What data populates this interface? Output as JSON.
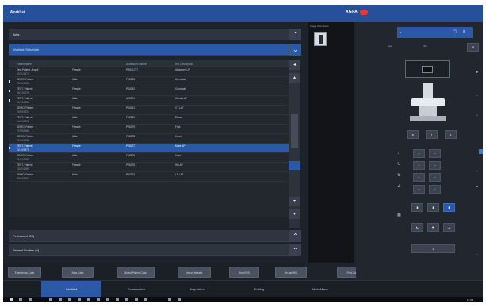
{
  "app": {
    "title": "Worklist",
    "brand": "AGFA"
  },
  "collapsed_rows": [
    "Jobs",
    "Worklist: Schedule",
    "Performed (23)",
    "Recent Studies (4)"
  ],
  "worklist": {
    "headers": [
      "Patient name",
      "Accession Number",
      "RIS Description"
    ],
    "rows": [
      {
        "name": "Test-Patient, Angeli",
        "sub": "02/11/1974",
        "gender": "Female",
        "acc": "PR001277",
        "desc": "Abdomen UP"
      },
      {
        "name": "DEMO, Patient",
        "sub": "03/11/1985",
        "gender": "Male",
        "acc": "P00283",
        "desc": "Cervicale"
      },
      {
        "name": "TEST, Patient",
        "sub": "05/12/1978",
        "gender": "Female",
        "acc": "P00282",
        "desc": "Cervicale"
      },
      {
        "name": "TEST, Patient",
        "sub": "01/03/1980",
        "gender": "Male",
        "acc": "A00001",
        "desc": "Chest LAT"
      },
      {
        "name": "DEMO, Patient",
        "sub": "02/05/1972",
        "gender": "Female",
        "acc": "P00281",
        "desc": "CT LAT"
      },
      {
        "name": "TEST, Patient",
        "sub": "04/06/1990",
        "gender": "Male",
        "acc": "P00280",
        "desc": "Elbow"
      },
      {
        "name": "DEMO, Patient",
        "sub": "07/08/1966",
        "gender": "Female",
        "acc": "P00279",
        "desc": "Foot"
      },
      {
        "name": "DEMO, Patient",
        "sub": "09/10/1988",
        "gender": "Male",
        "acc": "P00278",
        "desc": "Hand"
      },
      {
        "name": "TEST, Patient",
        "sub": "11/12/1975",
        "gender": "Female",
        "acc": "P00277",
        "desc": "Knee AP"
      },
      {
        "name": "DEMO, Patient",
        "sub": "12/01/1983",
        "gender": "Male",
        "acc": "P00276",
        "desc": "Knee"
      },
      {
        "name": "TEST, Patient",
        "sub": "02/02/1969",
        "gender": "Female",
        "acc": "P00275",
        "desc": "Hip AP"
      },
      {
        "name": "DEMO, Patient",
        "sub": "03/03/1991",
        "gender": "Male",
        "acc": "P00274",
        "desc": "LS LAT"
      }
    ]
  },
  "actions": [
    "Emergency Case",
    "New Case",
    "Select Patient Case",
    "Import Images",
    "Send RIS",
    "Re-use RIS",
    "Print Case"
  ],
  "thumbnails": {
    "label": "Image thumbnails"
  },
  "right_panel": {
    "count": "1",
    "auto": "Auto",
    "speed": "25",
    "exposure": "1"
  },
  "tabs": [
    "Worklist",
    "Examination",
    "Acquisition",
    "Editing",
    "Main Menu"
  ],
  "active_tab": "Worklist",
  "taskbar": {
    "clock": "11:25"
  },
  "colors": {
    "accent": "#2a5aa7",
    "panel": "#1e232b",
    "brand_red": "#e23b3b"
  }
}
